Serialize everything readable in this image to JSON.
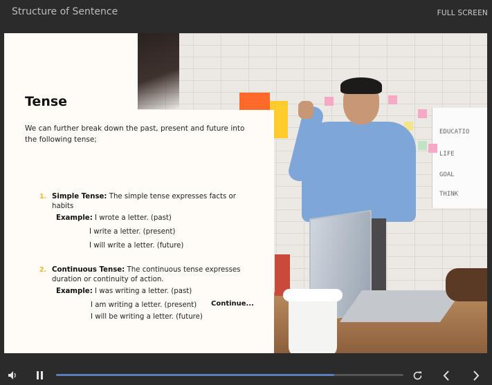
{
  "header": {
    "course_title": "Structure of Sentence",
    "fullscreen_label": "FULL SCREEN"
  },
  "slide": {
    "heading": "Tense",
    "intro": "We can further break down the past, present and future into the following tense;",
    "items": [
      {
        "number": "1.",
        "term": "Simple Tense:",
        "description": " The simple tense expresses facts or habits",
        "example_label": "Example:",
        "examples": [
          "I wrote a letter. (past)",
          "I write a letter. (present)",
          "I will write a letter. (future)"
        ]
      },
      {
        "number": "2.",
        "term": "Continuous Tense:",
        "description": " The continuous tense expresses duration or continuity of action.",
        "example_label": "Example:",
        "examples": [
          "I was writing a letter. (past)",
          "I am writing a letter. (present)",
          "I will be writing a letter. (future)"
        ]
      }
    ],
    "continue_label": "Continue...",
    "photo_whiteboard": [
      "EDUCATIO",
      "LIFE",
      "GOAL",
      "THINK"
    ],
    "colors": {
      "accent_orange": "#ff6a2b",
      "accent_yellow": "#ffcc2e",
      "number_color": "#f0b526"
    }
  },
  "player": {
    "volume_icon": "speaker-icon",
    "pause_icon": "pause-icon",
    "replay_icon": "replay-icon",
    "prev_icon": "chevron-left-icon",
    "next_icon": "chevron-right-icon",
    "progress": 0.8,
    "progress_color": "#5a7fb8"
  }
}
